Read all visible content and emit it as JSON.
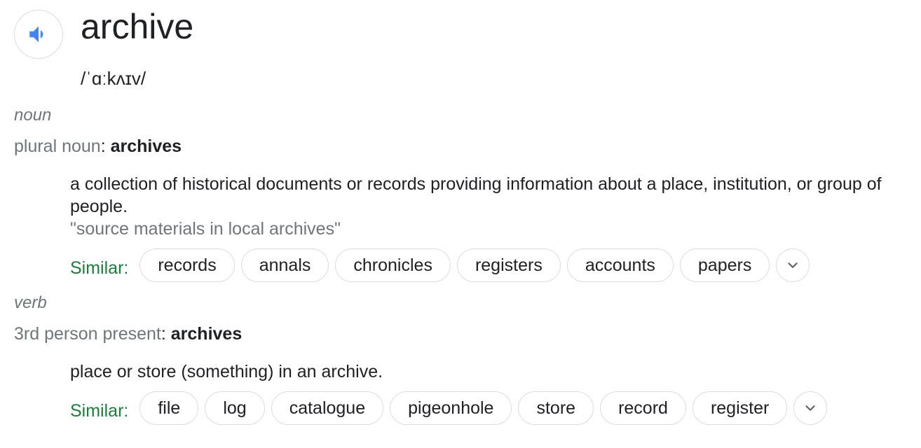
{
  "entry": {
    "word": "archive",
    "phonetic": "/ˈɑːkʌɪv/",
    "speaker_icon": "speaker-icon",
    "accent_color": "#4285f4"
  },
  "senses": [
    {
      "part_of_speech": "noun",
      "inflection_label": "plural noun",
      "inflection_sep": ":",
      "inflection_value": "archives",
      "definition": "a collection of historical documents or records providing information about a place, institution, or group of people.",
      "example": "\"source materials in local archives\"",
      "similar_label": "Similar:",
      "similar": [
        "records",
        "annals",
        "chronicles",
        "registers",
        "accounts",
        "papers"
      ],
      "more_icon": "chevron-down-icon"
    },
    {
      "part_of_speech": "verb",
      "inflection_label": "3rd person present",
      "inflection_sep": ":",
      "inflection_value": "archives",
      "definition": "place or store (something) in an archive.",
      "similar_label": "Similar:",
      "similar": [
        "file",
        "log",
        "catalogue",
        "pigeonhole",
        "store",
        "record",
        "register"
      ],
      "more_icon": "chevron-down-icon"
    }
  ]
}
